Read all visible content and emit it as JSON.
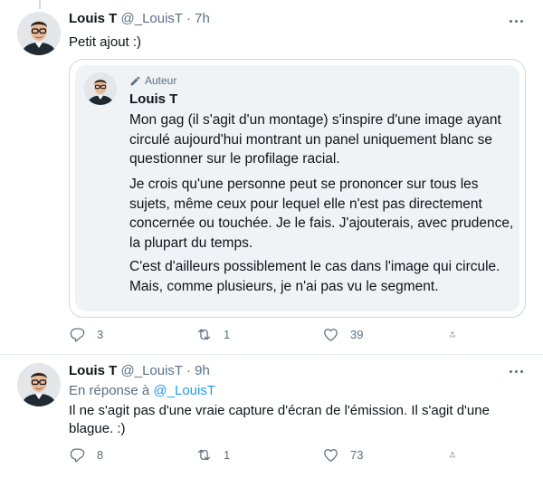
{
  "tweets": [
    {
      "name": "Louis T",
      "handle": "@_LouisT",
      "separator": "·",
      "time": "7h",
      "text": "Petit ajout :)",
      "quote": {
        "author_tag": "Auteur",
        "name": "Louis T",
        "paragraphs": [
          "Mon gag (il s'agit d'un montage) s'inspire d'une image ayant circulé aujourd'hui montrant un panel uniquement blanc se questionner sur le profilage racial.",
          "Je crois qu'une personne peut se prononcer sur tous les sujets, même ceux pour lequel elle n'est pas directement concernée ou touchée. Je le fais. J'ajouterais, avec prudence, la plupart du temps.",
          "C'est d'ailleurs possiblement le cas dans l'image qui circule. Mais, comme plusieurs, je n'ai pas vu le segment."
        ]
      },
      "actions": {
        "replies": "3",
        "retweets": "1",
        "likes": "39"
      }
    },
    {
      "name": "Louis T",
      "handle": "@_LouisT",
      "separator": "·",
      "time": "9h",
      "reply_prefix": "En réponse à",
      "reply_handle": "@_LouisT",
      "text": "Il ne s'agit pas d'une vraie capture d'écran de l'émission. Il s'agit d'une blague. :)",
      "actions": {
        "replies": "8",
        "retweets": "1",
        "likes": "73"
      }
    }
  ],
  "icons": {
    "reply": "reply-icon",
    "retweet": "retweet-icon",
    "like": "heart-icon",
    "share": "share-icon",
    "more": "more-icon",
    "author": "pencil-icon"
  },
  "colors": {
    "text": "#0f1419",
    "muted": "#5b7083",
    "link": "#1d9bf0",
    "border": "#cfd9de",
    "quote_bg": "#f0f3f5"
  }
}
